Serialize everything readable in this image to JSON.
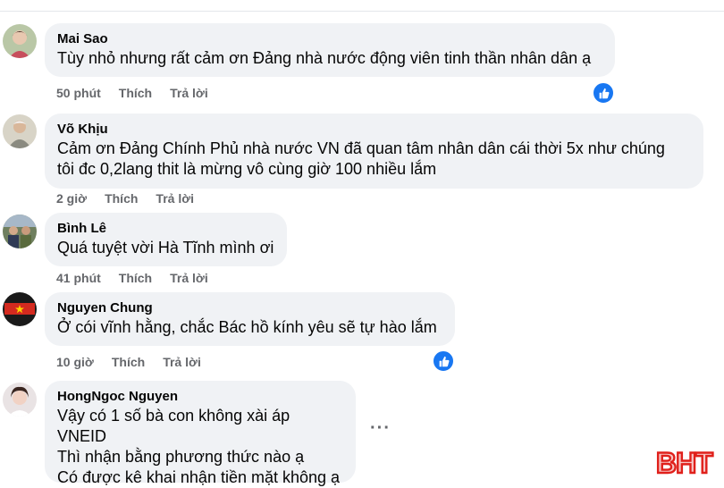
{
  "comments": [
    {
      "author": "Mai Sao",
      "text": "Tùy nhỏ nhưng rất cảm ơn Đảng nhà nước động viên tinh thần nhân dân ạ",
      "time": "50 phút",
      "like_label": "Thích",
      "reply_label": "Trả lời",
      "has_reaction": true
    },
    {
      "author": "Võ Khịu",
      "text": "Cảm ơn Đảng Chính Phủ nhà nước VN đã quan tâm nhân dân cái thời 5x như chúng\ntôi đc 0,2lang thit là mừng vô cùng giờ 100 nhiều lắm",
      "time": "2 giờ",
      "like_label": "Thích",
      "reply_label": "Trả lời",
      "has_reaction": false
    },
    {
      "author": "Bình Lê",
      "text": "Quá tuyệt vời Hà Tĩnh mình ơi",
      "time": "41 phút",
      "like_label": "Thích",
      "reply_label": "Trả lời",
      "has_reaction": false
    },
    {
      "author": "Nguyen Chung",
      "text": "Ở cói vĩnh hằng, chắc Bác hồ kính yêu sẽ tự hào lắm",
      "time": "10 giờ",
      "like_label": "Thích",
      "reply_label": "Trả lời",
      "has_reaction": true
    },
    {
      "author": "HongNgoc Nguyen",
      "text": "Vậy có 1 số bà con không xài áp VNEID\nThì nhận bằng phương thức nào ạ\nCó được kê khai nhận tiền mặt không ạ",
      "has_reaction": false
    }
  ],
  "more_options": "···",
  "watermark": "BHT",
  "colors": {
    "bubble": "#f0f2f5",
    "like_blue": "#1877f2",
    "meta_gray": "#65676b",
    "watermark_red": "#e0201b"
  }
}
